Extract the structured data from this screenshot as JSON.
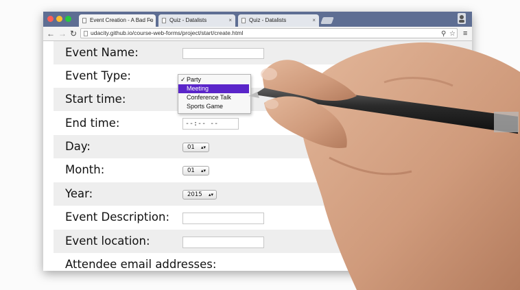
{
  "browser": {
    "tabs": [
      {
        "label": "Event Creation - A Bad Fo",
        "active": true
      },
      {
        "label": "Quiz - Datalists",
        "active": false
      },
      {
        "label": "Quiz - Datalists",
        "active": false
      }
    ],
    "close_glyph": "×",
    "nav": {
      "back": "←",
      "forward": "→",
      "reload": "↻"
    },
    "url": "udacity.github.io/course-web-forms/project/start/create.html",
    "icons": [
      "page-icon",
      "zoom-icon",
      "bookmark-star-icon",
      "menu-icon",
      "user-icon"
    ],
    "colors": {
      "tabstrip": "#5e6e93",
      "close": "#ff5f57",
      "minimize": "#ffbd2e",
      "zoom": "#28c840"
    }
  },
  "form": {
    "labels": {
      "event_name": "Event Name:",
      "event_type": "Event Type:",
      "start_time": "Start time:",
      "end_time": "End time:",
      "day": "Day:",
      "month": "Month:",
      "year": "Year:",
      "event_description": "Event Description:",
      "event_location": "Event location:",
      "attendee_emails": "Attendee email addresses:"
    },
    "end_time_value": "--:-- --",
    "day_value": "01",
    "month_value": "01",
    "year_value": "2015",
    "select_arrow": "▲▼"
  },
  "dropdown": {
    "options": [
      "Party",
      "Meeting",
      "Conference Talk",
      "Sports Game"
    ],
    "checked": "Party",
    "highlighted": "Meeting",
    "check_glyph": "✓",
    "highlight_color": "#5a25c9"
  }
}
